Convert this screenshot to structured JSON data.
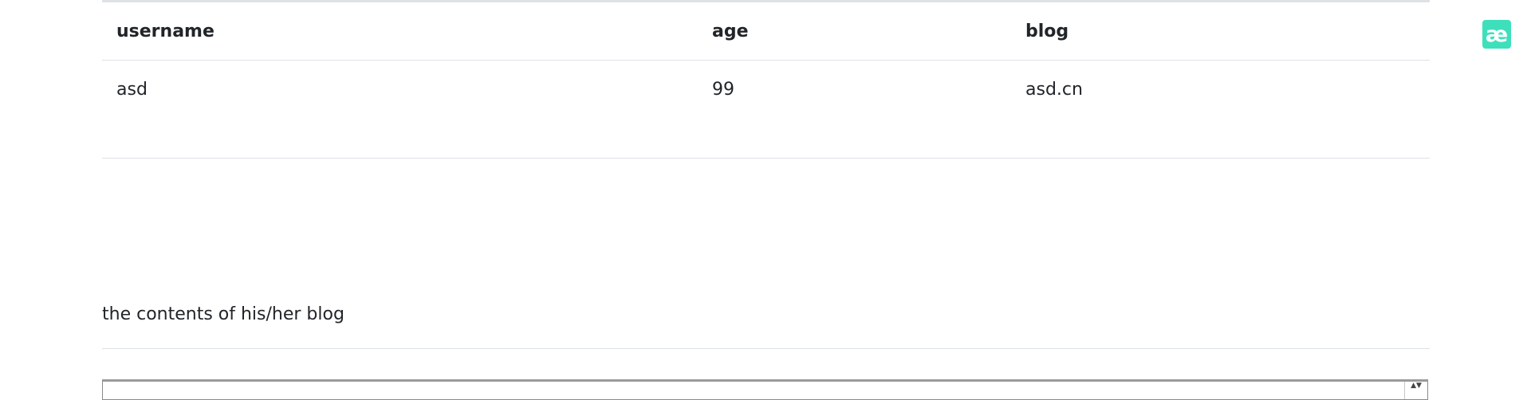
{
  "table": {
    "headers": [
      "username",
      "age",
      "blog"
    ],
    "rows": [
      {
        "username": "asd",
        "age": "99",
        "blog": "asd.cn"
      }
    ]
  },
  "blog_section": {
    "title": "the contents of his/her blog",
    "content": ""
  },
  "extension": {
    "icon_glyph": "æ",
    "icon": "ae-extension-icon",
    "color": "#3ee0bb"
  }
}
